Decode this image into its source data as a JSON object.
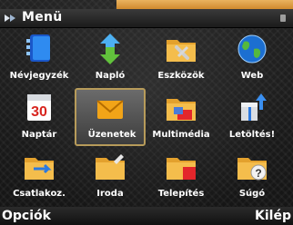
{
  "header": {
    "title": "Menü"
  },
  "grid": {
    "items": [
      {
        "label": "Névjegyzék",
        "icon": "contacts-book-icon"
      },
      {
        "label": "Napló",
        "icon": "log-arrows-icon"
      },
      {
        "label": "Eszközök",
        "icon": "tools-folder-icon"
      },
      {
        "label": "Web",
        "icon": "globe-icon"
      },
      {
        "label": "Naptár",
        "icon": "calendar-icon",
        "day": "30"
      },
      {
        "label": "Üzenetek",
        "icon": "envelope-icon"
      },
      {
        "label": "Multimédia",
        "icon": "multimedia-folder-icon"
      },
      {
        "label": "Letöltés!",
        "icon": "download-gift-icon"
      },
      {
        "label": "Csatlakoz.",
        "icon": "connectivity-folder-icon"
      },
      {
        "label": "Iroda",
        "icon": "office-folder-icon"
      },
      {
        "label": "Telepítés",
        "icon": "install-folder-icon"
      },
      {
        "label": "Súgó",
        "icon": "help-folder-icon"
      }
    ],
    "selected_index": 5
  },
  "softkeys": {
    "left": "Opciók",
    "right": "Kilép"
  },
  "colors": {
    "selection_border": "#b79b5a",
    "accent_top": "#e0a048"
  }
}
